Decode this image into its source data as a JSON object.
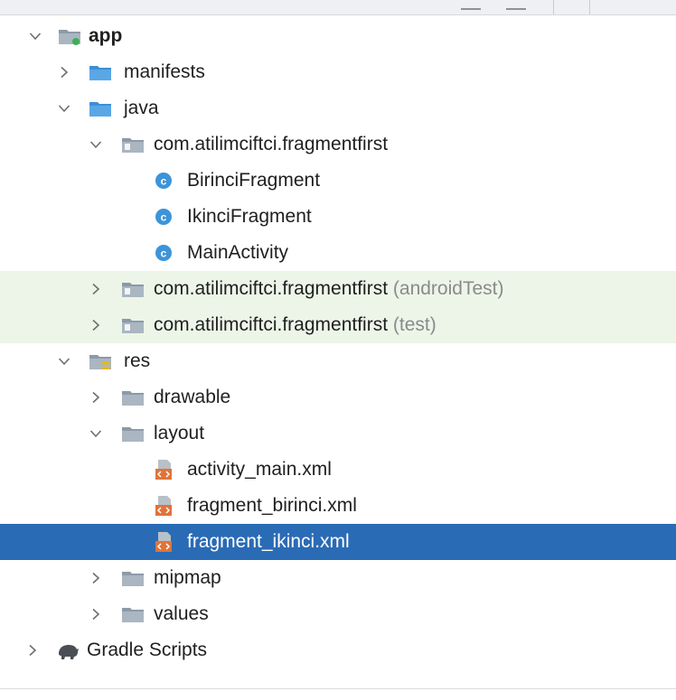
{
  "colors": {
    "folder_blue": "#3d8fd6",
    "folder_gray": "#9aa8b5",
    "class_circle": "#3d94d8",
    "xml_orange": "#e0733a",
    "selection": "#2a6bb5",
    "test_highlight": "#edf5e8"
  },
  "tree": {
    "app": {
      "label": "app",
      "icon": "module-folder-icon",
      "expanded": true
    },
    "manifests": {
      "label": "manifests",
      "icon": "folder-icon",
      "expanded": false
    },
    "java": {
      "label": "java",
      "icon": "folder-icon",
      "expanded": true
    },
    "pkg_main": {
      "label": "com.atilimciftci.fragmentfirst",
      "icon": "package-icon",
      "expanded": true
    },
    "birinci": {
      "label": "BirinciFragment",
      "icon": "class-icon"
    },
    "ikinci": {
      "label": "IkinciFragment",
      "icon": "class-icon"
    },
    "main_activity": {
      "label": "MainActivity",
      "icon": "class-icon"
    },
    "pkg_android_test": {
      "label": "com.atilimciftci.fragmentfirst",
      "suffix": "(androidTest)",
      "icon": "package-icon",
      "expanded": false
    },
    "pkg_test": {
      "label": "com.atilimciftci.fragmentfirst",
      "suffix": "(test)",
      "icon": "package-icon",
      "expanded": false
    },
    "res": {
      "label": "res",
      "icon": "resources-folder-icon",
      "expanded": true
    },
    "drawable": {
      "label": "drawable",
      "icon": "folder-icon",
      "expanded": false
    },
    "layout": {
      "label": "layout",
      "icon": "folder-icon",
      "expanded": true
    },
    "activity_main": {
      "label": "activity_main.xml",
      "icon": "layout-xml-icon"
    },
    "fragment_birinci": {
      "label": "fragment_birinci.xml",
      "icon": "layout-xml-icon"
    },
    "fragment_ikinci": {
      "label": "fragment_ikinci.xml",
      "icon": "layout-xml-icon",
      "selected": true
    },
    "mipmap": {
      "label": "mipmap",
      "icon": "folder-icon",
      "expanded": false
    },
    "values": {
      "label": "values",
      "icon": "folder-icon",
      "expanded": false
    },
    "gradle_scripts": {
      "label": "Gradle Scripts",
      "icon": "gradle-elephant-icon",
      "expanded": false
    }
  }
}
